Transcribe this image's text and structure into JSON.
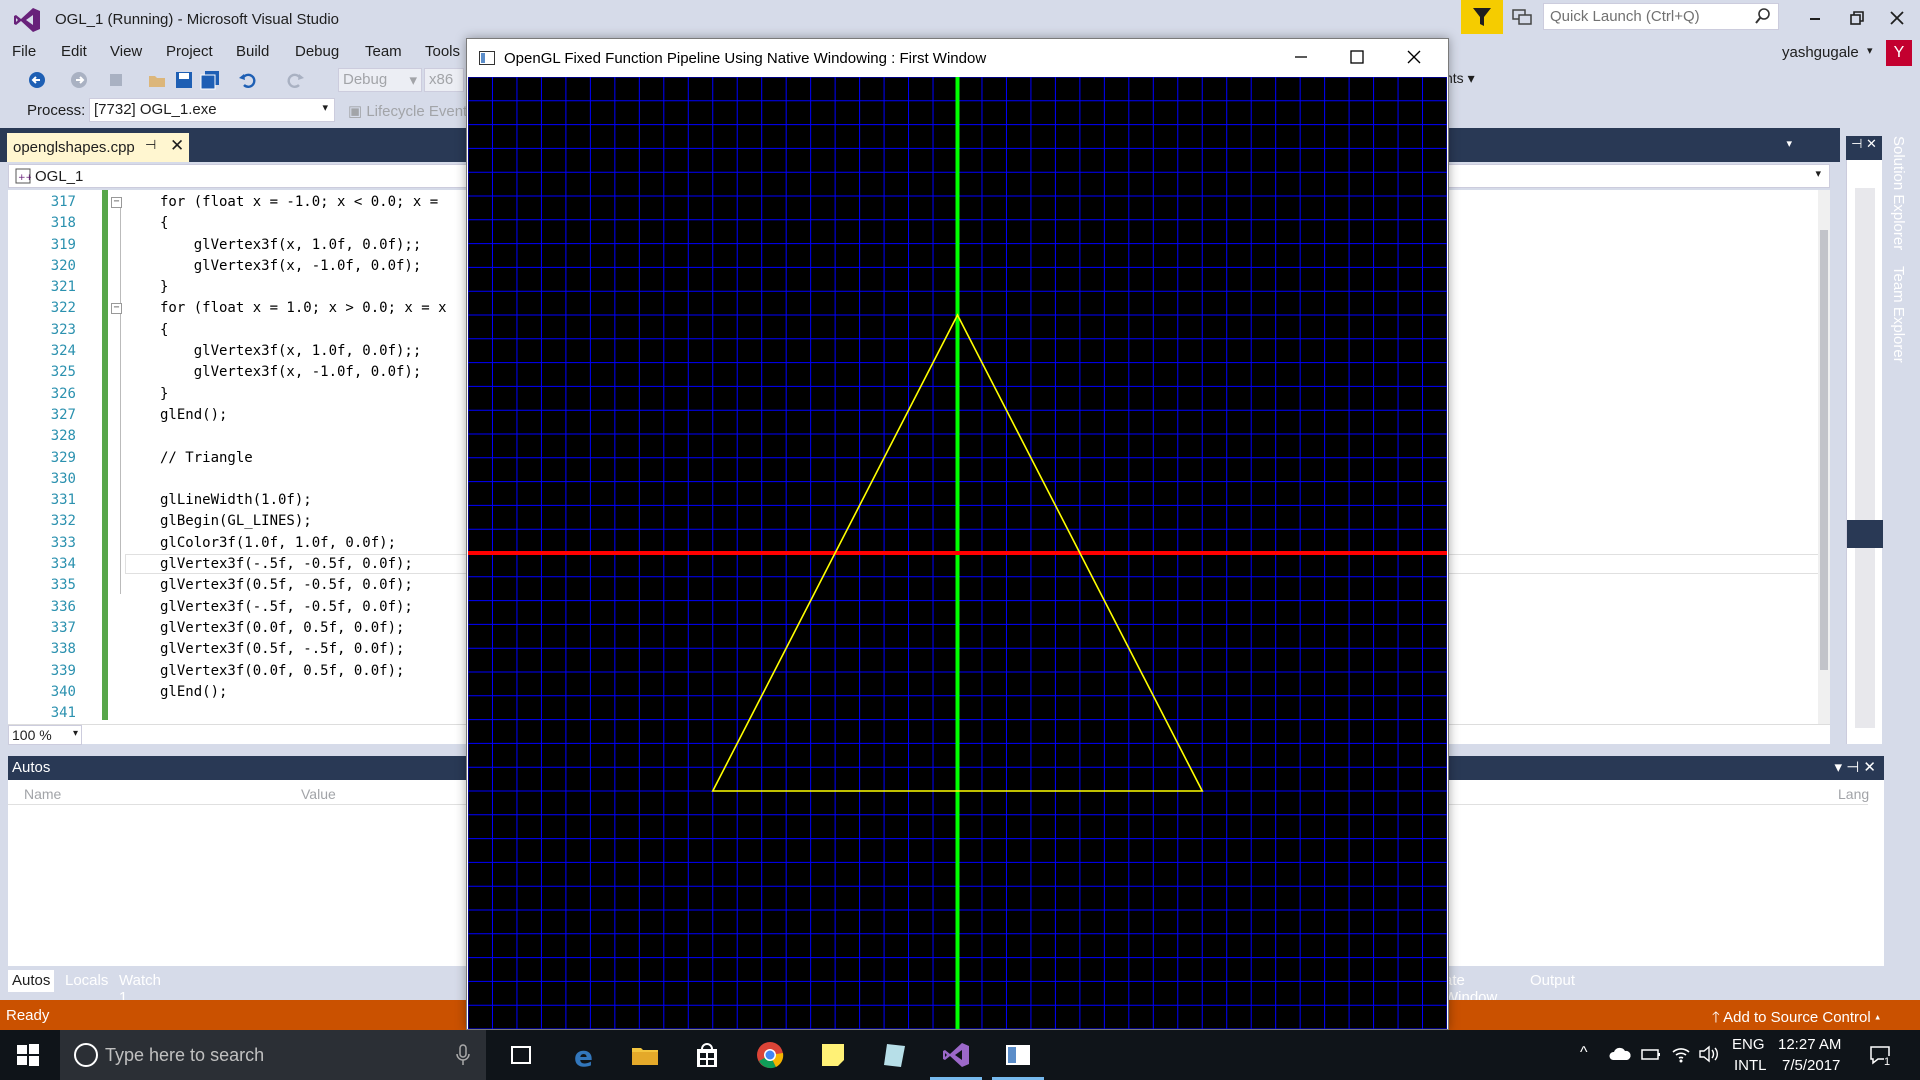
{
  "vs": {
    "title": "OGL_1 (Running) - Microsoft Visual Studio",
    "quick_launch_placeholder": "Quick Launch (Ctrl+Q)",
    "user": "yashgugale",
    "user_initial": "Y",
    "menu": [
      "File",
      "Edit",
      "View",
      "Project",
      "Build",
      "Debug",
      "Team",
      "Tools"
    ],
    "toolbar": {
      "config": "Debug",
      "platform": "x86",
      "right_text": "hts",
      "process_label": "Process:",
      "process_value": "[7732] OGL_1.exe",
      "lifecycle": "Lifecycle Events"
    },
    "accent": "#ca5100",
    "tab_strip_color": "#293955"
  },
  "editor": {
    "tab_name": "openglshapes.cpp",
    "tab_pin": "⊣",
    "tab_close": "✕",
    "project": "OGL_1",
    "zoom": "100 %",
    "lines": [
      {
        "no": "317",
        "code": "for (float x = -1.0; x < 0.0; x =",
        "fold": true
      },
      {
        "no": "318",
        "code": "{",
        "fold": false
      },
      {
        "no": "319",
        "code": "    glVertex3f(x, 1.0f, 0.0f);;",
        "fold": false
      },
      {
        "no": "320",
        "code": "    glVertex3f(x, -1.0f, 0.0f);",
        "fold": false
      },
      {
        "no": "321",
        "code": "}",
        "fold": false
      },
      {
        "no": "322",
        "code": "for (float x = 1.0; x > 0.0; x = x",
        "fold": true
      },
      {
        "no": "323",
        "code": "{",
        "fold": false
      },
      {
        "no": "324",
        "code": "    glVertex3f(x, 1.0f, 0.0f);;",
        "fold": false
      },
      {
        "no": "325",
        "code": "    glVertex3f(x, -1.0f, 0.0f);",
        "fold": false
      },
      {
        "no": "326",
        "code": "}",
        "fold": false
      },
      {
        "no": "327",
        "code": "glEnd();",
        "fold": false
      },
      {
        "no": "328",
        "code": "",
        "fold": false
      },
      {
        "no": "329",
        "code": "// Triangle",
        "fold": false
      },
      {
        "no": "330",
        "code": "",
        "fold": false
      },
      {
        "no": "331",
        "code": "glLineWidth(1.0f);",
        "fold": false
      },
      {
        "no": "332",
        "code": "glBegin(GL_LINES);",
        "fold": false
      },
      {
        "no": "333",
        "code": "glColor3f(1.0f, 1.0f, 0.0f);",
        "fold": false
      },
      {
        "no": "334",
        "code": "glVertex3f(-.5f, -0.5f, 0.0f);",
        "fold": false
      },
      {
        "no": "335",
        "code": "glVertex3f(0.5f, -0.5f, 0.0f);",
        "fold": false
      },
      {
        "no": "336",
        "code": "glVertex3f(-.5f, -0.5f, 0.0f);",
        "fold": false
      },
      {
        "no": "337",
        "code": "glVertex3f(0.0f, 0.5f, 0.0f);",
        "fold": false
      },
      {
        "no": "338",
        "code": "glVertex3f(0.5f, -.5f, 0.0f);",
        "fold": false
      },
      {
        "no": "339",
        "code": "glVertex3f(0.0f, 0.5f, 0.0f);",
        "fold": false
      },
      {
        "no": "340",
        "code": "glEnd();",
        "fold": false
      },
      {
        "no": "341",
        "code": "",
        "fold": false
      }
    ]
  },
  "side_tabs": [
    "Solution Explorer",
    "Team Explorer"
  ],
  "autos": {
    "title": "Autos",
    "columns": [
      "Name",
      "Value",
      "Lang"
    ],
    "tabs": [
      "Autos",
      "Locals",
      "Watch 1"
    ],
    "right_tabs": [
      "ate Window",
      "Output"
    ]
  },
  "status": {
    "text": "Ready",
    "source_control": "Add to Source Control"
  },
  "gl_window": {
    "title": "OpenGL Fixed Function Pipeline Using Native Windowing : First Window",
    "grid_color": "#0000ff",
    "x_axis_color": "#ff0000",
    "y_axis_color": "#00ff00",
    "triangle_color": "#ffff00",
    "grid_lines_per_side": 20,
    "triangle": [
      [
        -0.5,
        -0.5
      ],
      [
        0.5,
        -0.5
      ],
      [
        0.0,
        0.5
      ]
    ]
  },
  "taskbar": {
    "search_placeholder": "Type here to search",
    "lang_1": "ENG",
    "lang_2": "INTL",
    "time": "12:27 AM",
    "date": "7/5/2017",
    "notification_count": "1"
  }
}
